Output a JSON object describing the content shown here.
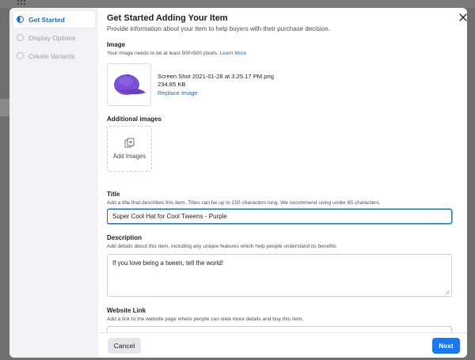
{
  "sidebar": {
    "steps": [
      {
        "label": "Get Started",
        "active": true
      },
      {
        "label": "Display Options",
        "active": false
      },
      {
        "label": "Create Variants",
        "active": false
      }
    ]
  },
  "header": {
    "title": "Get Started Adding Your Item",
    "subtitle": "Provide information about your item to help buyers with their purchase decision."
  },
  "image": {
    "label": "Image",
    "hint": "Your image needs to be at least 500×500 pixels.",
    "learn_more": "Learn More",
    "file_name": "Screen Shot 2021-01-28 at 3.25.17 PM.png",
    "file_size": "234.85 KB",
    "replace": "Replace image"
  },
  "additional_images": {
    "label": "Additional images",
    "add_label": "Add Images"
  },
  "title_field": {
    "label": "Title",
    "hint": "Add a title that describes this item. Titles can be up to 150 characters long. We recommend using under 65 characters.",
    "value": "Super Cool Hat for Cool Tweens - Purple"
  },
  "description_field": {
    "label": "Description",
    "hint": "Add details about this item, including any unique features which help people understand its benefits.",
    "value": "If you love being a tween, tell the world!"
  },
  "website_field": {
    "label": "Website Link",
    "hint": "Add a link to the website page where people can view more details and buy this item.",
    "value": ""
  },
  "footer": {
    "cancel": "Cancel",
    "next": "Next"
  },
  "colors": {
    "accent": "#1877f2",
    "product": "#7b4fd6"
  },
  "icons": {
    "close": "close-icon",
    "add_images": "add-images-icon"
  }
}
